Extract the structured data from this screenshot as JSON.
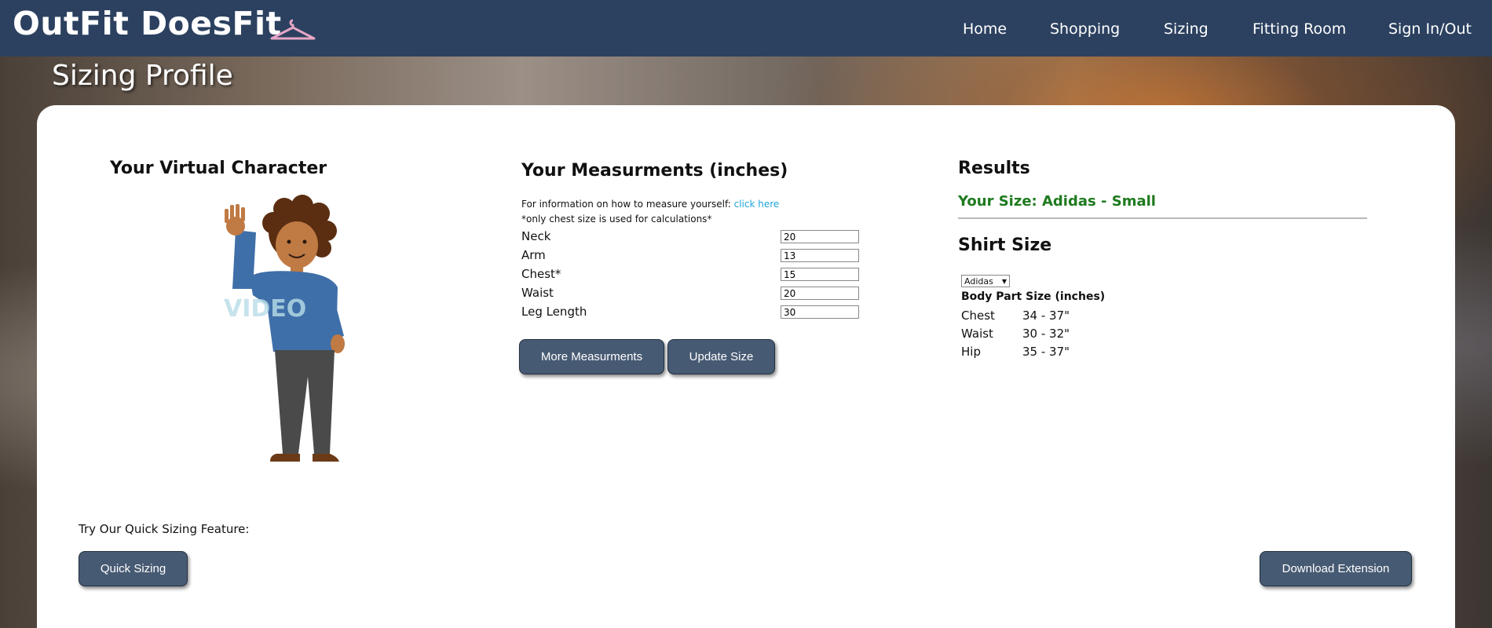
{
  "header": {
    "brand": "OutFit DoesFit",
    "nav": [
      "Home",
      "Shopping",
      "Sizing",
      "Fitting Room",
      "Sign In/Out"
    ]
  },
  "page_title": "Sizing Profile",
  "character": {
    "heading": "Your Virtual Character",
    "watermark": "VIDEO"
  },
  "measurements": {
    "heading": "Your Measurments (inches)",
    "info_text": "For information on how to measure yourself:",
    "info_link": "click here",
    "note": "*only chest size is used for calculations*",
    "fields": [
      {
        "label": "Neck",
        "value": "20"
      },
      {
        "label": "Arm",
        "value": "13"
      },
      {
        "label": "Chest*",
        "value": "15"
      },
      {
        "label": "Waist",
        "value": "20"
      },
      {
        "label": "Leg Length",
        "value": "30"
      }
    ],
    "more_button": "More Measurments",
    "update_button": "Update Size"
  },
  "results": {
    "heading": "Results",
    "your_size": "Your Size: Adidas - Small",
    "shirt_heading": "Shirt Size",
    "brand_select": "Adidas",
    "table_header": "Body Part Size (inches)",
    "rows": [
      {
        "part": "Chest",
        "size": "34 - 37\""
      },
      {
        "part": "Waist",
        "size": "30 - 32\""
      },
      {
        "part": "Hip",
        "size": "35 - 37\""
      }
    ]
  },
  "quick": {
    "label": "Try Our Quick Sizing Feature:",
    "button": "Quick Sizing"
  },
  "download_button": "Download Extension",
  "colors": {
    "navbar": "#2c4160",
    "button": "#475a73",
    "result_green": "#1e7a1e",
    "link": "#1ea6d8"
  }
}
